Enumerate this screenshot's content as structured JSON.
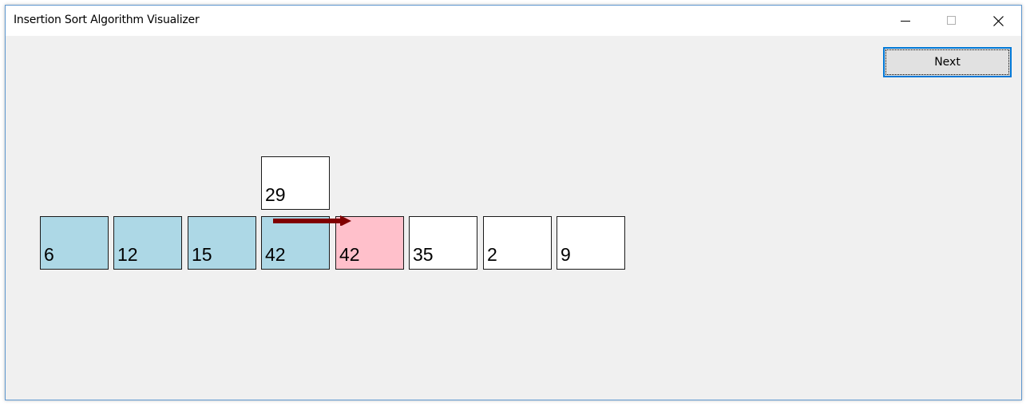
{
  "window": {
    "title": "Insertion Sort Algorithm Visualizer",
    "controls": [
      "minimize-icon",
      "maximize-icon",
      "close-icon"
    ]
  },
  "toolbar": {
    "next_label": "Next"
  },
  "array": {
    "cells": [
      {
        "value": "6",
        "state": "sorted"
      },
      {
        "value": "12",
        "state": "sorted"
      },
      {
        "value": "15",
        "state": "sorted"
      },
      {
        "value": "42",
        "state": "sorted"
      },
      {
        "value": "42",
        "state": "shifted"
      },
      {
        "value": "35",
        "state": "unsorted"
      },
      {
        "value": "2",
        "state": "unsorted"
      },
      {
        "value": "9",
        "state": "unsorted"
      }
    ],
    "key": {
      "value": "29",
      "above_index": 3
    },
    "shift_arrow": {
      "from_index": 3,
      "to_index": 4,
      "icon": "right-arrow-icon"
    }
  },
  "colors": {
    "sorted": "#add8e6",
    "shifted": "#ffc0cb",
    "unsorted": "#ffffff",
    "arrow": "#800000",
    "accent": "#0078d7"
  }
}
